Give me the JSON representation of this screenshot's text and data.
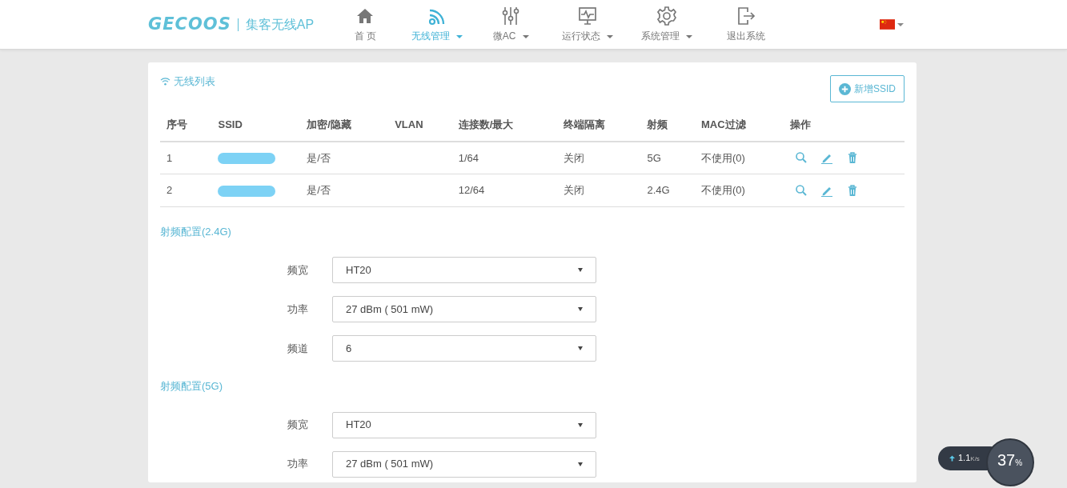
{
  "header": {
    "logo": "GECOOS",
    "product": "集客无线AP",
    "nav": [
      {
        "label": "首 页",
        "kind": "home",
        "dropdown": false,
        "selected": false
      },
      {
        "label": "无线管理",
        "kind": "wifi",
        "dropdown": true,
        "selected": true
      },
      {
        "label": "微AC",
        "kind": "sliders",
        "dropdown": true,
        "selected": false
      },
      {
        "label": "运行状态",
        "kind": "monitor",
        "dropdown": true,
        "selected": false
      },
      {
        "label": "系统管理",
        "kind": "gear",
        "dropdown": true,
        "selected": false
      },
      {
        "label": "退出系统",
        "kind": "exit",
        "dropdown": false,
        "selected": false
      }
    ]
  },
  "wireless_list": {
    "title": "无线列表",
    "add_button": "新增SSID",
    "columns": [
      "序号",
      "SSID",
      "加密/隐藏",
      "VLAN",
      "连接数/最大",
      "终端隔离",
      "射频",
      "MAC过滤",
      "操作"
    ],
    "rows": [
      {
        "index": "1",
        "encryption_hidden": "是/否",
        "connections": "1/64",
        "isolation": "关闭",
        "band": "5G",
        "mac_filter": "不使用(0)"
      },
      {
        "index": "2",
        "encryption_hidden": "是/否",
        "connections": "12/64",
        "isolation": "关闭",
        "band": "2.4G",
        "mac_filter": "不使用(0)"
      }
    ]
  },
  "radio_sections": [
    {
      "title": "射频配置(2.4G)",
      "fields": [
        {
          "label": "频宽",
          "value": "HT20"
        },
        {
          "label": "功率",
          "value": "27 dBm ( 501 mW)"
        },
        {
          "label": "频道",
          "value": "6"
        }
      ]
    },
    {
      "title": "射频配置(5G)",
      "fields": [
        {
          "label": "频宽",
          "value": "HT20"
        },
        {
          "label": "功率",
          "value": "27 dBm ( 501 mW)"
        }
      ]
    }
  ],
  "speed_widget": {
    "speed": "1.1",
    "unit": "K/s",
    "load": "37",
    "load_unit": "%"
  }
}
